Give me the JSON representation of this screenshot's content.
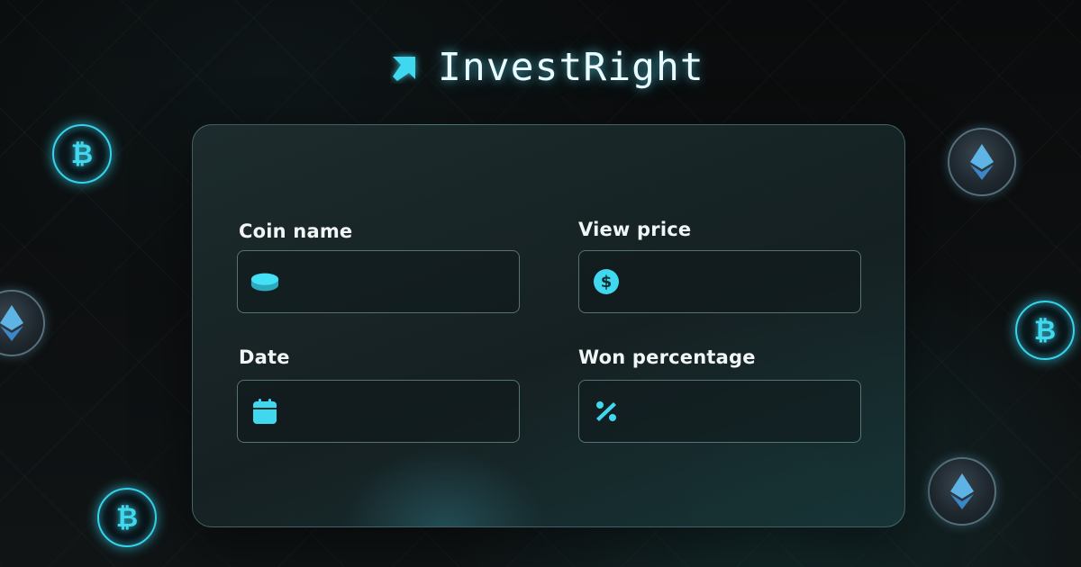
{
  "brand": {
    "name": "InvestRight",
    "icon": "arrow-up-right-icon"
  },
  "form": {
    "fields": [
      {
        "label": "Coin name",
        "icon": "coin-icon",
        "value": ""
      },
      {
        "label": "View price",
        "icon": "dollar-circle-icon",
        "value": ""
      },
      {
        "label": "Date",
        "icon": "calendar-icon",
        "value": ""
      },
      {
        "label": "Won percentage",
        "icon": "percent-icon",
        "value": ""
      }
    ]
  },
  "decorations": {
    "coins": [
      "bitcoin-coin",
      "ethereum-coin",
      "bitcoin-coin",
      "ethereum-coin",
      "bitcoin-coin",
      "ethereum-coin"
    ]
  },
  "colors": {
    "accent": "#3fd8ef",
    "background": "#0b0d0e",
    "card": "#1a2a2c",
    "text": "#f1f5f5"
  }
}
